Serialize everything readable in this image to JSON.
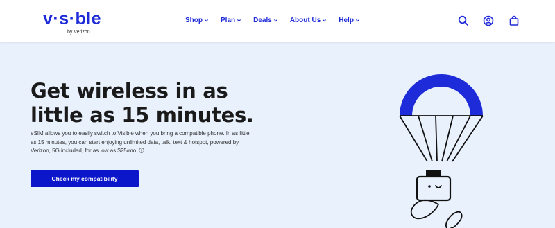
{
  "brand": {
    "logo_text": "v·s·ble",
    "logo_sub": "by Verizon",
    "accent_color": "#1e2bd8",
    "cta_color": "#0b15c9",
    "hero_bg": "#e9f1fc"
  },
  "nav": {
    "items": [
      {
        "label": "Shop"
      },
      {
        "label": "Plan"
      },
      {
        "label": "Deals"
      },
      {
        "label": "About Us"
      },
      {
        "label": "Help"
      }
    ]
  },
  "header_icons": [
    "search-icon",
    "account-icon",
    "cart-icon"
  ],
  "hero": {
    "headline": "Get wireless in as little as 15 minutes.",
    "description": "eSIM allows you to easily switch to Visible when you bring a compatible phone. In as little as 15 minutes, you can start enjoying unlimited data, talk, text & hotspot, powered by Verizon, 5G included, for as low as $25/mo.",
    "cta_label": "Check my compatibility",
    "illustration": "parachute-sim-card-hand-illustration"
  }
}
